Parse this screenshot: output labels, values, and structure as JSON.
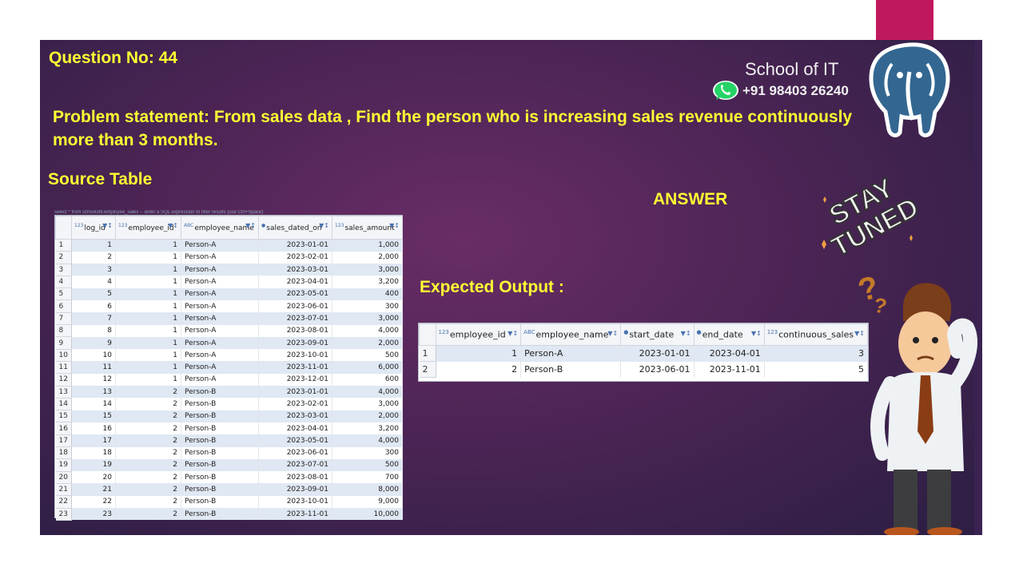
{
  "question_label": "Question No: 44",
  "problem_statement": "Problem statement:  From sales data , Find the person  who is increasing sales revenue continuously more than 3 months.",
  "source_table_title": "Source Table",
  "answer_label": "ANSWER",
  "expected_output_label": "Expected  Output :",
  "branding": {
    "school": "School of IT",
    "phone": "+91 98403 26240"
  },
  "source_query_strip": "select * from schoolofit.employee_sales -- enter a SQL expression to filter results (use Ctrl+Space)",
  "source_table": {
    "columns": [
      {
        "type": "123",
        "name": "log_id"
      },
      {
        "type": "123",
        "name": "employee_id"
      },
      {
        "type": "ABC",
        "name": "employee_name"
      },
      {
        "type": "date",
        "name": "sales_dated_on"
      },
      {
        "type": "123",
        "name": "sales_amount"
      }
    ],
    "rows": [
      [
        "1",
        "1",
        "1",
        "Person-A",
        "2023-01-01",
        "1,000"
      ],
      [
        "2",
        "2",
        "1",
        "Person-A",
        "2023-02-01",
        "2,000"
      ],
      [
        "3",
        "3",
        "1",
        "Person-A",
        "2023-03-01",
        "3,000"
      ],
      [
        "4",
        "4",
        "1",
        "Person-A",
        "2023-04-01",
        "3,200"
      ],
      [
        "5",
        "5",
        "1",
        "Person-A",
        "2023-05-01",
        "400"
      ],
      [
        "6",
        "6",
        "1",
        "Person-A",
        "2023-06-01",
        "300"
      ],
      [
        "7",
        "7",
        "1",
        "Person-A",
        "2023-07-01",
        "3,000"
      ],
      [
        "8",
        "8",
        "1",
        "Person-A",
        "2023-08-01",
        "4,000"
      ],
      [
        "9",
        "9",
        "1",
        "Person-A",
        "2023-09-01",
        "2,000"
      ],
      [
        "10",
        "10",
        "1",
        "Person-A",
        "2023-10-01",
        "500"
      ],
      [
        "11",
        "11",
        "1",
        "Person-A",
        "2023-11-01",
        "6,000"
      ],
      [
        "12",
        "12",
        "1",
        "Person-A",
        "2023-12-01",
        "600"
      ],
      [
        "13",
        "13",
        "2",
        "Person-B",
        "2023-01-01",
        "4,000"
      ],
      [
        "14",
        "14",
        "2",
        "Person-B",
        "2023-02-01",
        "3,000"
      ],
      [
        "15",
        "15",
        "2",
        "Person-B",
        "2023-03-01",
        "2,000"
      ],
      [
        "16",
        "16",
        "2",
        "Person-B",
        "2023-04-01",
        "3,200"
      ],
      [
        "17",
        "17",
        "2",
        "Person-B",
        "2023-05-01",
        "4,000"
      ],
      [
        "18",
        "18",
        "2",
        "Person-B",
        "2023-06-01",
        "300"
      ],
      [
        "19",
        "19",
        "2",
        "Person-B",
        "2023-07-01",
        "500"
      ],
      [
        "20",
        "20",
        "2",
        "Person-B",
        "2023-08-01",
        "700"
      ],
      [
        "21",
        "21",
        "2",
        "Person-B",
        "2023-09-01",
        "8,000"
      ],
      [
        "22",
        "22",
        "2",
        "Person-B",
        "2023-10-01",
        "9,000"
      ],
      [
        "23",
        "23",
        "2",
        "Person-B",
        "2023-11-01",
        "10,000"
      ]
    ]
  },
  "output_table": {
    "columns": [
      {
        "type": "123",
        "name": "employee_id"
      },
      {
        "type": "ABC",
        "name": "employee_name"
      },
      {
        "type": "date",
        "name": "start_date"
      },
      {
        "type": "date",
        "name": "end_date"
      },
      {
        "type": "123",
        "name": "continuous_sales"
      }
    ],
    "rows": [
      [
        "1",
        "1",
        "Person-A",
        "2023-01-01",
        "2023-04-01",
        "3"
      ],
      [
        "2",
        "2",
        "Person-B",
        "2023-06-01",
        "2023-11-01",
        "5"
      ]
    ]
  },
  "stay_tuned_text": [
    "STAY",
    "TUNED"
  ],
  "icons": {
    "whatsapp": "whatsapp-icon",
    "elephant": "postgresql-elephant-logo",
    "stay_tuned": "stay-tuned-badge",
    "confused_person": "confused-person-illustration",
    "sort_filter": "sort-filter-icon"
  },
  "colors": {
    "heading_yellow": "#ffff33",
    "slide_purple": "#4e2556",
    "pink_bar": "#c0185e",
    "row_stripe": "#dfe8f3"
  }
}
